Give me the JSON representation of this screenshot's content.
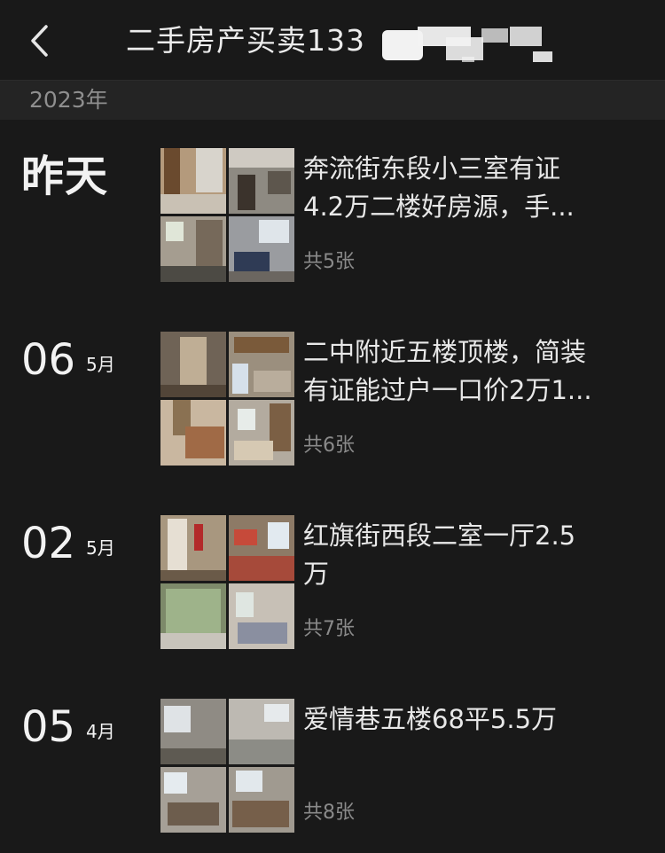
{
  "header": {
    "title": "二手房产买卖133"
  },
  "year": "2023年",
  "posts": [
    {
      "date_text": "昨天",
      "lines": [
        "奔流街东段小三室有证",
        "4.2万二楼好房源，手..."
      ],
      "count": "共5张"
    },
    {
      "day": "06",
      "month": "5月",
      "lines": [
        "二中附近五楼顶楼，简装",
        "有证能过户一口价2万1..."
      ],
      "count": "共6张"
    },
    {
      "day": "02",
      "month": "5月",
      "lines": [
        "红旗街西段二室一厅2.5",
        "万"
      ],
      "count": "共7张"
    },
    {
      "day": "05",
      "month": "4月",
      "lines": [
        "爱情巷五楼68平5.5万"
      ],
      "count": "共8张"
    }
  ],
  "colors": {
    "background": "#191919",
    "year_bar": "#242424",
    "text_primary": "#e8e8e8",
    "text_secondary": "#8a8a8a"
  },
  "icons": {
    "back": "chevron-left-icon"
  }
}
